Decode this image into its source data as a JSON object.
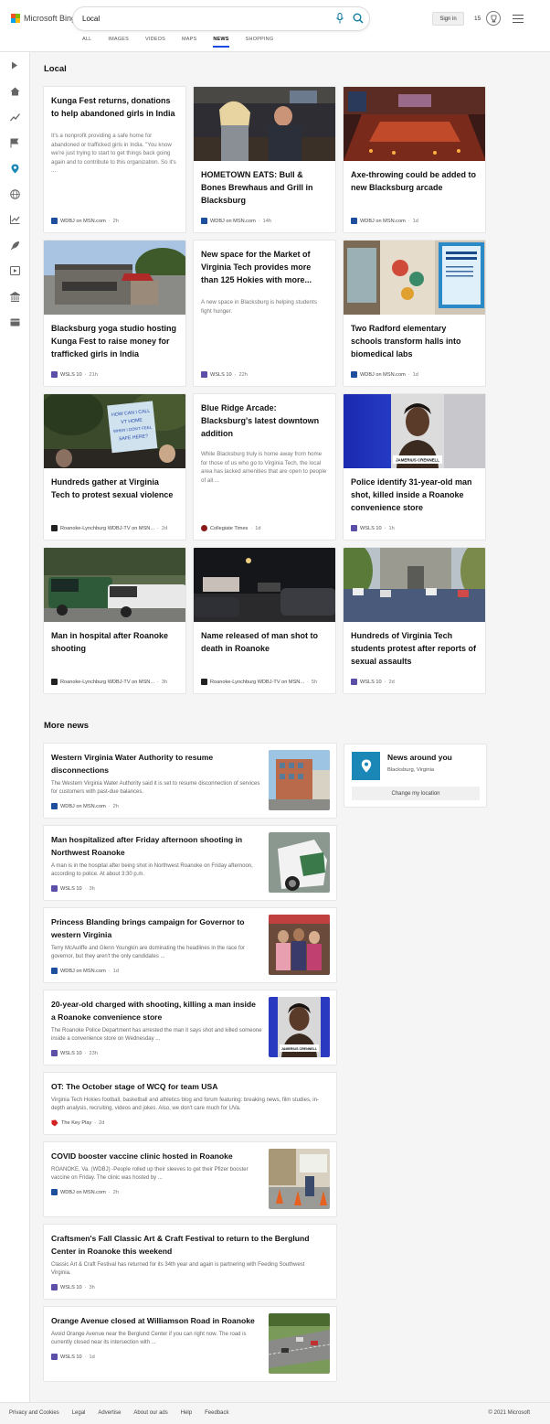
{
  "header": {
    "logo_text": "Microsoft Bing",
    "query": "Local",
    "sign_in": "Sign in",
    "rewards_count": "15",
    "scopes": [
      "ALL",
      "IMAGES",
      "VIDEOS",
      "MAPS",
      "NEWS",
      "SHOPPING"
    ],
    "active_scope": "NEWS"
  },
  "local": {
    "title": "Local",
    "cards": [
      {
        "title": "Kunga Fest returns, donations to help abandoned girls in India",
        "snippet": "It's a nonprofit providing a safe home for abandoned or trafficked girls in India. \"You know we're just trying to start to get things back going again and to contribute to this organization. So it's ...",
        "source": "WDBJ on MSN.com",
        "time": "2h",
        "image": "none",
        "source_icon": "wdbj"
      },
      {
        "title": "HOMETOWN EATS: Bull & Bones Brewhaus and Grill in Blacksburg",
        "snippet": "",
        "source": "WDBJ on MSN.com",
        "time": "14h",
        "image": "restaurant-interview",
        "source_icon": "wdbj"
      },
      {
        "title": "Axe-throwing could be added to new Blacksburg arcade",
        "snippet": "",
        "source": "WDBJ on MSN.com",
        "time": "1d",
        "image": "arcade-interior",
        "source_icon": "wdbj"
      },
      {
        "title": "Blacksburg yoga studio hosting Kunga Fest to raise money for trafficked girls in India",
        "snippet": "",
        "source": "WSLS 10",
        "time": "21h",
        "image": "yoga-studio-building",
        "source_icon": "wsls"
      },
      {
        "title": "New space for the Market of Virginia Tech provides more than 125 Hokies with more...",
        "snippet": "A new space in Blacksburg is helping students fight hunger.",
        "source": "WSLS 10",
        "time": "22h",
        "image": "none",
        "source_icon": "wsls"
      },
      {
        "title": "Two Radford elementary schools transform halls into biomedical labs",
        "snippet": "",
        "source": "WDBJ on MSN.com",
        "time": "1d",
        "image": "school-hallway-mural",
        "source_icon": "wdbj"
      },
      {
        "title": "Hundreds gather at Virginia Tech to protest sexual violence",
        "snippet": "",
        "source": "Roanoke-Lynchburg WDBJ-TV on MSN...",
        "time": "2d",
        "image": "protest-sign",
        "source_icon": "wdbj-tv",
        "sign_text": [
          "HOW CAN I CALL",
          "VT HOME",
          "WHEN I DON'T FEEL",
          "SAFE HERE?"
        ]
      },
      {
        "title": "Blue Ridge Arcade: Blacksburg's latest downtown addition",
        "snippet": "While Blacksburg truly is home away from home for those of us who go to Virginia Tech, the local area has lacked amenities that are open to people of all ...",
        "source": "Collegiate Times",
        "time": "1d",
        "image": "none",
        "source_icon": "collegiate"
      },
      {
        "title": "Police identify 31-year-old man shot, killed inside a Roanoke convenience store",
        "snippet": "",
        "source": "WSLS 10",
        "time": "1h",
        "image": "mugshot",
        "source_icon": "wsls",
        "image_caption": "JAMERIUS CRENNELL"
      },
      {
        "title": "Man in hospital after Roanoke shooting",
        "snippet": "",
        "source": "Roanoke-Lynchburg WDBJ-TV on MSN...",
        "time": "3h",
        "image": "police-scene",
        "source_icon": "wdbj-tv"
      },
      {
        "title": "Name released of man shot to death in Roanoke",
        "snippet": "",
        "source": "Roanoke-Lynchburg WDBJ-TV on MSN...",
        "time": "5h",
        "image": "night-scene",
        "source_icon": "wdbj-tv"
      },
      {
        "title": "Hundreds of Virginia Tech students protest after reports of sexual assaults",
        "snippet": "",
        "source": "WSLS 10",
        "time": "2d",
        "image": "campus-protest",
        "source_icon": "wsls"
      }
    ]
  },
  "more_news": {
    "title": "More news",
    "items": [
      {
        "title": "Western Virginia Water Authority to resume disconnections",
        "snippet": "The Western Virginia Water Authority said it is set to resume disconnection of services for customers with past-due balances.",
        "source": "WDBJ on MSN.com",
        "time": "2h",
        "thumb": "building"
      },
      {
        "title": "Man hospitalized after Friday afternoon shooting in Northwest Roanoke",
        "snippet": "A man is in the hospital after being shot in Northwest Roanoke on Friday afternoon, according to police. At about 3:30 p.m.",
        "source": "WSLS 10",
        "time": "3h",
        "thumb": "police-car"
      },
      {
        "title": "Princess Blanding brings campaign for Governor to western Virginia",
        "snippet": "Terry McAuliffe and Glenn Youngkin are dominating the headlines in the race for governor, but they aren't the only candidates ...",
        "source": "WDBJ on MSN.com",
        "time": "1d",
        "thumb": "group-photo"
      },
      {
        "title": "20-year-old charged with shooting, killing a man inside a Roanoke convenience store",
        "snippet": "The Roanoke Police Department has arrested the man it says shot and killed someone inside a convenience store on Wednesday ...",
        "source": "WSLS 10",
        "time": "23h",
        "thumb": "mugshot",
        "thumb_caption": "JAMERIUS CRENNELL"
      },
      {
        "title": "OT: The October stage of WCQ for team USA",
        "snippet": "Virginia Tech Hokies football, basketball and athletics blog and forum featuring: breaking news, film studies, in-depth analysis, recruiting, videos and jokes. Also, we don't care much for UVa.",
        "source": "The Key Play",
        "time": "2d",
        "thumb": "none"
      },
      {
        "title": "COVID booster vaccine clinic hosted in Roanoke",
        "snippet": "ROANOKE, Va. (WDBJ) -People rolled up their sleeves to get their Pfizer booster vaccine on Friday. The clinic was hosted by ...",
        "source": "WDBJ on MSN.com",
        "time": "2h",
        "thumb": "vaccine-clinic"
      },
      {
        "title": "Craftsmen's Fall Classic Art & Craft Festival to return to the Berglund Center in Roanoke this weekend",
        "snippet": "Classic Art & Craft Festival has returned for its 34th year and again is partnering with Feeding Southwest Virginia.",
        "source": "WSLS 10",
        "time": "3h",
        "thumb": "none"
      },
      {
        "title": "Orange Avenue closed at Williamson Road in Roanoke",
        "snippet": "Avoid Orange Avenue near the Berglund Center if you can right now. The road is currently closed near its intersection with ...",
        "source": "WSLS 10",
        "time": "1d",
        "thumb": "road"
      }
    ]
  },
  "news_around": {
    "title": "News around you",
    "location": "Blacksburg, Virginia",
    "button": "Change my location"
  },
  "footer": {
    "links": [
      "Privacy and Cookies",
      "Legal",
      "Advertise",
      "About our ads",
      "Help",
      "Feedback"
    ],
    "copyright": "© 2021 Microsoft"
  },
  "colors": {
    "accent": "#174ae4",
    "location_tile": "#1a87b7",
    "wdbj": "#1d4f9c",
    "wsls": "#5b4fa8",
    "collegiate": "#8b1a1a",
    "keyplay": "#d42020"
  }
}
